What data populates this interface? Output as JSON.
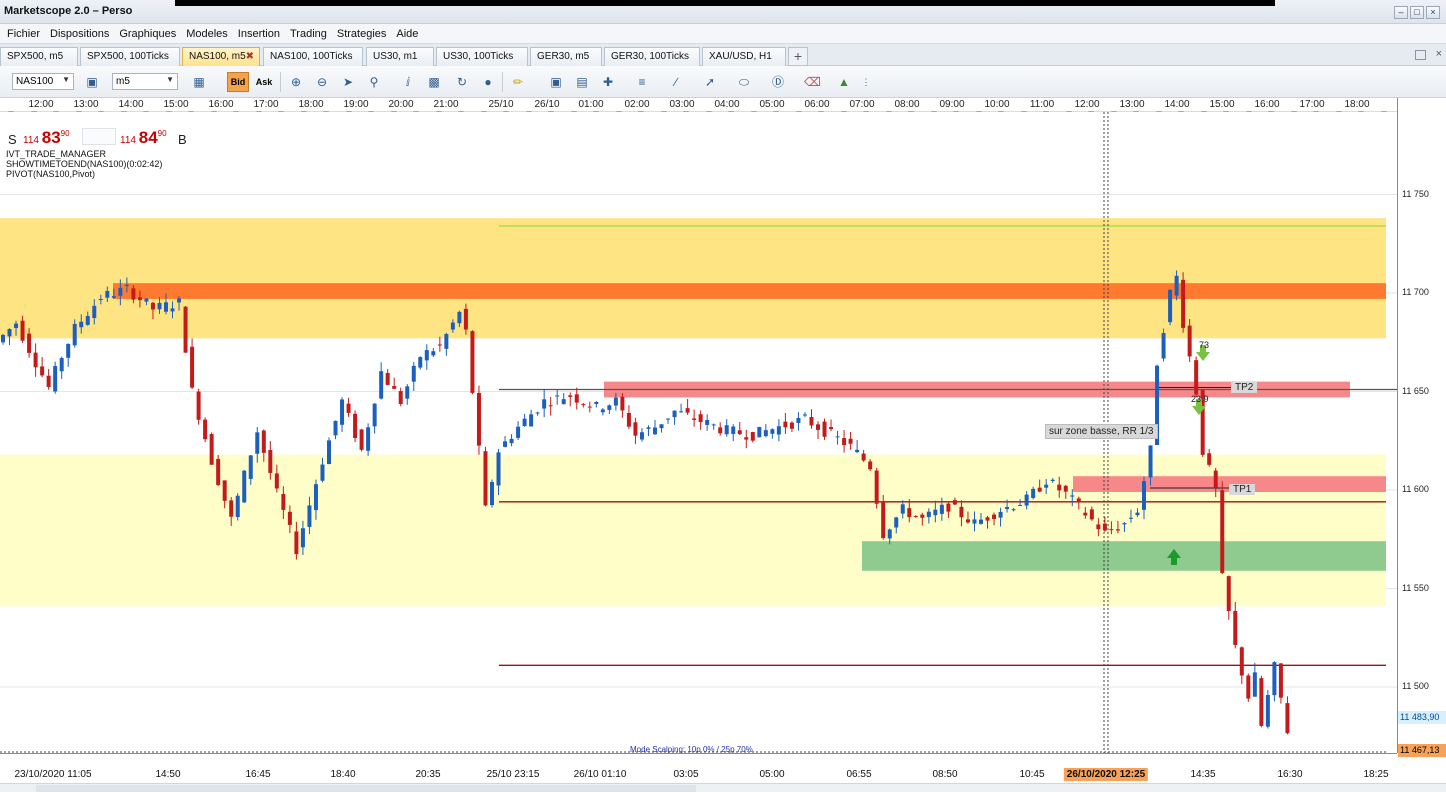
{
  "window": {
    "title": "Marketscope 2.0 – Perso"
  },
  "menu": [
    "Fichier",
    "Dispositions",
    "Graphiques",
    "Modeles",
    "Insertion",
    "Trading",
    "Strategies",
    "Aide"
  ],
  "tabs": [
    {
      "label": "SPX500, m5",
      "active": false
    },
    {
      "label": "SPX500, 100Ticks",
      "active": false
    },
    {
      "label": "NAS100, m5",
      "active": true
    },
    {
      "label": "NAS100, 100Ticks",
      "active": false
    },
    {
      "label": "US30, m1",
      "active": false
    },
    {
      "label": "US30, 100Ticks",
      "active": false
    },
    {
      "label": "GER30, m5",
      "active": false
    },
    {
      "label": "GER30, 100Ticks",
      "active": false
    },
    {
      "label": "XAU/USD, H1",
      "active": false
    }
  ],
  "toolbar": {
    "instrument": "NAS100",
    "timeframe": "m5",
    "bid_label": "Bid",
    "ask_label": "Ask"
  },
  "quote": {
    "sell_label": "S",
    "buy_label": "B",
    "sell_prefix": "114",
    "sell_big": "83",
    "sell_sup": "90",
    "buy_prefix": "114",
    "buy_big": "84",
    "buy_sup": "90"
  },
  "indicators": [
    "IVT_TRADE_MANAGER",
    "SHOWTIMETOEND(NAS100)(0:02:42)",
    "PIVOT(NAS100,Pivot)"
  ],
  "top_axis": [
    "12:00",
    "13:00",
    "14:00",
    "15:00",
    "16:00",
    "17:00",
    "18:00",
    "19:00",
    "20:00",
    "21:00",
    "25/10",
    "26/10",
    "01:00",
    "02:00",
    "03:00",
    "04:00",
    "05:00",
    "06:00",
    "07:00",
    "08:00",
    "09:00",
    "10:00",
    "11:00",
    "12:00",
    "13:00",
    "14:00",
    "15:00",
    "16:00",
    "17:00",
    "18:00"
  ],
  "bottom_axis": [
    "23/10/2020 11:05",
    "14:50",
    "16:45",
    "18:40",
    "20:35",
    "25/10 23:15",
    "26/10 01:10",
    "03:05",
    "05:00",
    "06:55",
    "08:50",
    "10:45",
    "26/10/2020 12:25",
    "14:35",
    "16:30",
    "18:25"
  ],
  "bottom_axis_highlight": "26/10/2020 12:25",
  "price_labels": [
    "11 750",
    "11 700",
    "11 650",
    "11 600",
    "11 550",
    "11 500"
  ],
  "price_tags": {
    "current": "11 483,90",
    "low": "11 467,13"
  },
  "annotations": {
    "zone_note": "sur zone basse, RR 1/3",
    "tp1": "TP1",
    "tp2": "TP2",
    "label_73": "73",
    "label_239": "23.9",
    "mode": "Mode Scalping: 10p 0% / 25p 70%"
  },
  "chart_data": {
    "type": "candlestick",
    "instrument": "NAS100",
    "timeframe": "m5",
    "ylim": [
      11467,
      11770
    ],
    "price_path": [
      [
        0,
        11675
      ],
      [
        3,
        11685
      ],
      [
        6,
        11665
      ],
      [
        8,
        11652
      ],
      [
        10,
        11668
      ],
      [
        12,
        11682
      ],
      [
        16,
        11698
      ],
      [
        20,
        11702
      ],
      [
        24,
        11692
      ],
      [
        28,
        11695
      ],
      [
        30,
        11650
      ],
      [
        33,
        11615
      ],
      [
        36,
        11585
      ],
      [
        40,
        11630
      ],
      [
        43,
        11598
      ],
      [
        46,
        11570
      ],
      [
        50,
        11615
      ],
      [
        53,
        11645
      ],
      [
        56,
        11620
      ],
      [
        59,
        11660
      ],
      [
        62,
        11645
      ],
      [
        65,
        11668
      ],
      [
        68,
        11673
      ],
      [
        71,
        11690
      ],
      [
        72,
        11680
      ],
      [
        73,
        11650
      ],
      [
        75,
        11590
      ],
      [
        77,
        11620
      ],
      [
        80,
        11632
      ],
      [
        84,
        11645
      ],
      [
        88,
        11648
      ],
      [
        92,
        11642
      ],
      [
        95,
        11645
      ],
      [
        98,
        11628
      ],
      [
        101,
        11632
      ],
      [
        104,
        11640
      ],
      [
        108,
        11635
      ],
      [
        112,
        11630
      ],
      [
        116,
        11628
      ],
      [
        120,
        11632
      ],
      [
        124,
        11636
      ],
      [
        128,
        11628
      ],
      [
        131,
        11622
      ],
      [
        134,
        11612
      ],
      [
        136,
        11578
      ],
      [
        139,
        11590
      ],
      [
        142,
        11585
      ],
      [
        146,
        11592
      ],
      [
        150,
        11583
      ],
      [
        154,
        11590
      ],
      [
        158,
        11595
      ],
      [
        161,
        11605
      ],
      [
        164,
        11598
      ],
      [
        167,
        11588
      ],
      [
        170,
        11578
      ],
      [
        173,
        11583
      ],
      [
        175,
        11590
      ],
      [
        177,
        11620
      ],
      [
        178,
        11665
      ],
      [
        180,
        11700
      ],
      [
        181,
        11708
      ],
      [
        182,
        11685
      ],
      [
        184,
        11650
      ],
      [
        185,
        11620
      ],
      [
        187,
        11600
      ],
      [
        188,
        11555
      ],
      [
        190,
        11520
      ],
      [
        192,
        11495
      ],
      [
        193,
        11505
      ],
      [
        194,
        11480
      ],
      [
        196,
        11510
      ],
      [
        198,
        11478
      ]
    ],
    "zones": [
      {
        "price_from": 11677,
        "price_to": 11738,
        "color": "#ffe484"
      },
      {
        "price_from": 11541,
        "price_to": 11618,
        "color": "#fffdc8"
      },
      {
        "price_from": 11697,
        "price_to": 11705,
        "color": "#ff7a2e"
      },
      {
        "price_from": 11647,
        "price_to": 11655,
        "color": "#f7888a"
      },
      {
        "price_from": 11599,
        "price_to": 11607,
        "color": "#f7888a"
      },
      {
        "price_from": 11559,
        "price_to": 11574,
        "color": "#8fca8f"
      }
    ],
    "lines": [
      {
        "price": 11734,
        "color": "#9ddc3a"
      },
      {
        "price": 11651,
        "color": "#555555"
      },
      {
        "price": 11594,
        "color": "#a01010"
      },
      {
        "price": 11511,
        "color": "#a01010"
      },
      {
        "price": 11467,
        "color": "#666666",
        "dashed": true
      }
    ]
  }
}
